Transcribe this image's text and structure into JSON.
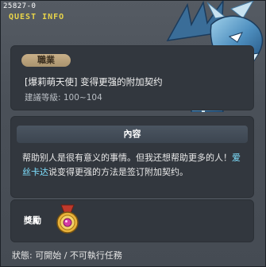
{
  "header": {
    "quest_id": "25827-0",
    "section": "QUEST INFO"
  },
  "job": {
    "badge": "職業"
  },
  "quest": {
    "title": "[爆莉萌天使] 变得更强的附加契约",
    "recommended_level": "建議等級: 100~104"
  },
  "content": {
    "header": "內容",
    "desc_part1": "帮助别人是很有意义的事情。但我还想帮助更多的人！",
    "desc_highlight": "爱丝卡达",
    "desc_part2": "说变得更强的方法是签订附加契约。"
  },
  "reward": {
    "label": "獎勵",
    "item_icon": "medal-icon"
  },
  "status": {
    "text": "狀態: 可開始 / 不可執行任務"
  },
  "colors": {
    "highlight": "#7ee0ff",
    "section_title": "#e8d44a",
    "badge": "#c9b089"
  }
}
